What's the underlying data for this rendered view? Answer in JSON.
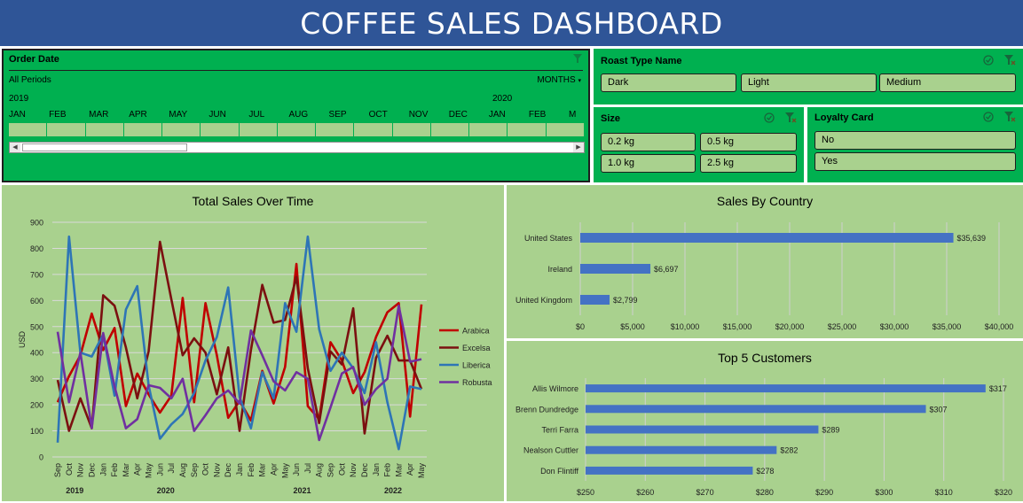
{
  "header": {
    "title": "COFFEE SALES DASHBOARD"
  },
  "timeline": {
    "title": "Order Date",
    "period": "All Periods",
    "level": "MONTHS",
    "years": [
      "2019",
      "2020"
    ],
    "months": [
      "JAN",
      "FEB",
      "MAR",
      "APR",
      "MAY",
      "JUN",
      "JUL",
      "AUG",
      "SEP",
      "OCT",
      "NOV",
      "DEC",
      "JAN",
      "FEB",
      "M"
    ]
  },
  "roast": {
    "title": "Roast Type Name",
    "items": [
      "Dark",
      "Light",
      "Medium"
    ]
  },
  "size": {
    "title": "Size",
    "items": [
      "0.2 kg",
      "0.5 kg",
      "1.0 kg",
      "2.5 kg"
    ]
  },
  "loyalty": {
    "title": "Loyalty Card",
    "items": [
      "No",
      "Yes"
    ]
  },
  "colors": {
    "header": "#2f5597",
    "slicer": "#00b050",
    "panel": "#a9d18e",
    "bar": "#4472c4"
  },
  "chart_data": [
    {
      "type": "line",
      "title": "Total Sales Over Time",
      "ylabel": "USD",
      "ylim": [
        0,
        900
      ],
      "yticks": [
        0,
        100,
        200,
        300,
        400,
        500,
        600,
        700,
        800,
        900
      ],
      "categories": [
        "Sep",
        "Oct",
        "Nov",
        "Dec",
        "Jan",
        "Feb",
        "Mar",
        "Apr",
        "May",
        "Jun",
        "Jul",
        "Aug",
        "Sep",
        "Oct",
        "Nov",
        "Dec",
        "Jan",
        "Feb",
        "Mar",
        "Apr",
        "May",
        "Jun",
        "Jul",
        "Aug",
        "Sep",
        "Oct",
        "Nov",
        "Dec",
        "Jan",
        "Feb",
        "Mar",
        "Apr",
        "May"
      ],
      "year_labels": [
        {
          "label": "2019",
          "at": 1.5
        },
        {
          "label": "2020",
          "at": 9.5
        },
        {
          "label": "2021",
          "at": 21.5
        },
        {
          "label": "2022",
          "at": 29.5
        }
      ],
      "legend": "right",
      "grid": true,
      "series": [
        {
          "name": "Arabica",
          "color": "#c00000",
          "values": [
            210,
            310,
            390,
            550,
            410,
            495,
            195,
            320,
            240,
            170,
            235,
            610,
            210,
            590,
            390,
            150,
            215,
            140,
            330,
            205,
            345,
            740,
            195,
            145,
            440,
            370,
            245,
            325,
            460,
            555,
            590,
            155,
            585
          ]
        },
        {
          "name": "Excelsa",
          "color": "#7b1010",
          "values": [
            295,
            100,
            225,
            110,
            620,
            580,
            420,
            225,
            405,
            825,
            605,
            390,
            455,
            400,
            240,
            420,
            100,
            410,
            660,
            515,
            525,
            690,
            340,
            130,
            405,
            355,
            570,
            90,
            380,
            465,
            370,
            370,
            260
          ]
        },
        {
          "name": "Liberica",
          "color": "#2e75b6",
          "values": [
            55,
            845,
            400,
            385,
            470,
            235,
            565,
            655,
            275,
            70,
            125,
            165,
            245,
            370,
            460,
            650,
            230,
            110,
            325,
            225,
            590,
            480,
            845,
            490,
            330,
            400,
            340,
            245,
            440,
            210,
            30,
            270,
            260
          ]
        },
        {
          "name": "Robusta",
          "color": "#7030a0",
          "values": [
            480,
            210,
            400,
            110,
            475,
            270,
            110,
            145,
            275,
            265,
            225,
            300,
            100,
            160,
            225,
            255,
            205,
            485,
            390,
            290,
            255,
            325,
            300,
            65,
            190,
            320,
            345,
            200,
            260,
            300,
            580,
            365,
            375
          ]
        }
      ]
    },
    {
      "type": "bar",
      "orientation": "horizontal",
      "title": "Sales By Country",
      "categories": [
        "United States",
        "Ireland",
        "United Kingdom"
      ],
      "values": [
        35639,
        6697,
        2799
      ],
      "value_labels": [
        "$35,639",
        "$6,697",
        "$2,799"
      ],
      "xlim": [
        0,
        40000
      ],
      "xticks": [
        "$0",
        "$5,000",
        "$10,000",
        "$15,000",
        "$20,000",
        "$25,000",
        "$30,000",
        "$35,000",
        "$40,000"
      ]
    },
    {
      "type": "bar",
      "orientation": "horizontal",
      "title": "Top 5 Customers",
      "categories": [
        "Allis Wilmore",
        "Brenn Dundredge",
        "Terri Farra",
        "Nealson Cuttler",
        "Don Flintiff"
      ],
      "values": [
        317,
        307,
        289,
        282,
        278
      ],
      "value_labels": [
        "$317",
        "$307",
        "$289",
        "$282",
        "$278"
      ],
      "xlim": [
        250,
        320
      ],
      "xticks": [
        "$250",
        "$260",
        "$270",
        "$280",
        "$290",
        "$300",
        "$310",
        "$320"
      ]
    }
  ]
}
